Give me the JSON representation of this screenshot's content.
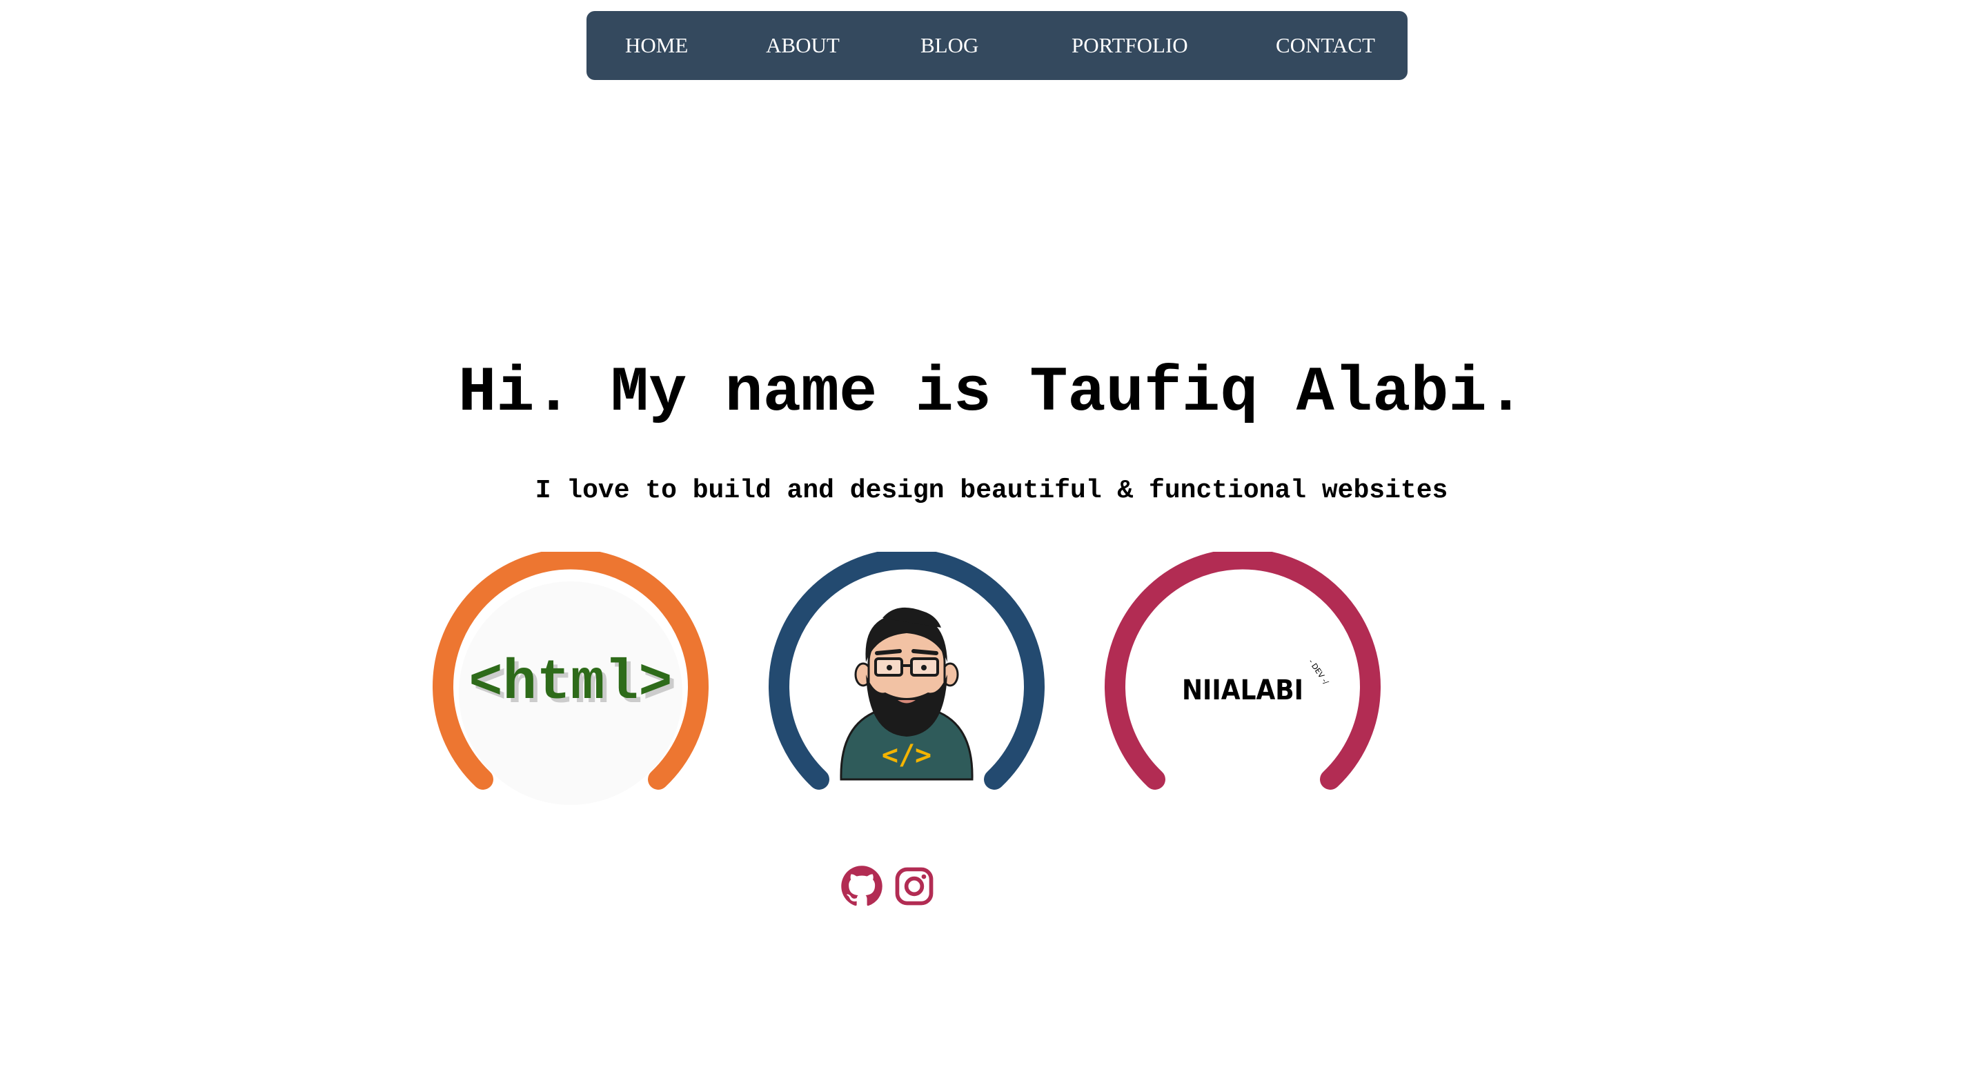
{
  "nav": {
    "items": [
      {
        "label": "HOME"
      },
      {
        "label": "ABOUT"
      },
      {
        "label": "BLOG"
      },
      {
        "label": "PORTFOLIO"
      },
      {
        "label": "CONTACT"
      }
    ]
  },
  "hero": {
    "title": "Hi. My name is Taufiq Alabi.",
    "subtitle": "I love to build and design beautiful & functional websites"
  },
  "cards": [
    {
      "name": "html-logo",
      "logo_text": "<html>",
      "ring_color": "#ed7631"
    },
    {
      "name": "avatar",
      "ring_color": "#234a70"
    },
    {
      "name": "brand-logo",
      "logo_text": "NIIALABI",
      "badge_text": "- DEV -/",
      "ring_color": "#b22c53"
    }
  ],
  "socials": [
    {
      "icon": "github-icon"
    },
    {
      "icon": "instagram-icon"
    }
  ],
  "colors": {
    "nav_bg": "#34495e",
    "social_icon": "#b22c53",
    "html_logo_text": "#2e6b1a"
  }
}
